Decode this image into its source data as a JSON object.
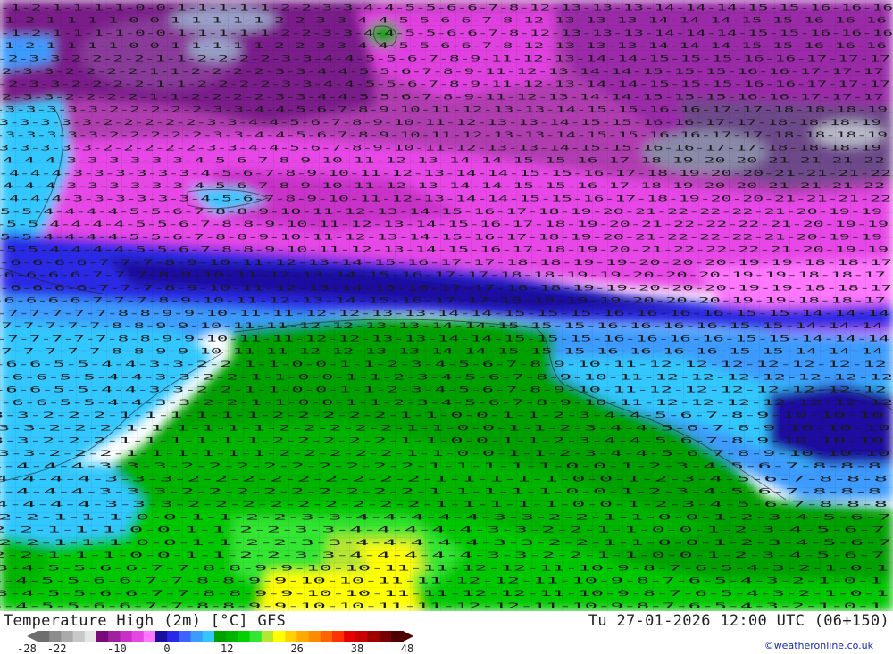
{
  "footer": {
    "title_left": "Temperature High (2m) [°C] GFS",
    "title_right": "Tu 27-01-2026 12:00 UTC (06+150)",
    "copyright": "©weatheronline.co.uk"
  },
  "scale": {
    "colors": [
      "#6e6e6e",
      "#8c8c8c",
      "#aaaaaa",
      "#c8c8c8",
      "#e6e6e6",
      "#7a0a7a",
      "#a020a0",
      "#c830c8",
      "#e646e6",
      "#ff78ff",
      "#1a10a0",
      "#2a2ae6",
      "#3c64ff",
      "#3c9bff",
      "#32c8ff",
      "#00a000",
      "#00b400",
      "#00d200",
      "#32e632",
      "#b4e632",
      "#ffff00",
      "#ffd200",
      "#ffaa00",
      "#ff8c00",
      "#ff6400",
      "#ff3200",
      "#e60000",
      "#c80000",
      "#a00000",
      "#780000",
      "#500000"
    ],
    "labels": [
      {
        "text": "-28",
        "value": -28
      },
      {
        "text": "-22",
        "value": -22
      },
      {
        "text": "-10",
        "value": -10
      },
      {
        "text": "0",
        "value": 0
      },
      {
        "text": "12",
        "value": 12
      },
      {
        "text": "26",
        "value": 26
      },
      {
        "text": "38",
        "value": 38
      },
      {
        "text": "48",
        "value": 48
      }
    ]
  },
  "map": {
    "grid_rows": [
      "-1-2-1-1-1-1-0-0-1-1-1-1-1-2-2-3-3-4-4-5-5-6-6-7-8-12-13-13-13-14-14-14-15-15-16-16-16",
      "-2-3-3-2-2-2-2-1-1-2-2-2-2-3-3-4-4-5-5-6-7-8-9-11-12-13-14-14-15-15-15-16-16-17-17-17",
      "-3-3-3-3-3-2-2-2-2-2-3-3-4-4-5-6-7-8-9-10-11-12-13-13-14-15-15-16-16-17-17-18-18-18-19",
      "-4-4-4-3-3-3-3-3-3-4-5-6-7-8-9-10-11-12-13-14-14-15-15-16-17-18-19-20-20-21-21-21-22",
      "-5-5-4-4-4-4-5-5-6-7-8-8-9-10-11-12-13-14-15-16-17-18-19-20-21-22-22-22-21-20-19-19",
      "-6-6-6-6-7-7-7-8-9-10-11-12-13-14-15-16-17-17-18-18-19-19-20-20-20-19-19-18-18-17",
      "-7-7-7-7-7-8-8-9-9-10-11-11-12-12-13-13-14-14-15-15-15-16-16-16-16-15-15-14-14-14",
      "-6-6-5-5-4-4-3-3-2-2-1-1-0-0-1-1-2-3-4-5-6-7-8-9-10-11-12-12-12-12-12-12-12",
      "3-3-2-2-2-1-1-1-1-1-1-2-2-2-2-2-1-1-0-0-1-1-2-3-4-4-5-6-7-8-9-10-10-10",
      "4-4-4-4-3-3-3-2-2-2-2-2-2-2-2-2-1-1-1-1-1-0-0-1-2-3-4-5-6-7-8-8-8",
      "2-2-1-1-1-0-0-1-1-2-2-3-3-4-4-4-4-4-3-3-2-2-1-1-0-0-1-2-3-4-5-6-7",
      "3-4-5-5-6-6-7-7-8-8-9-9-10-10-11-11-12-12-11-10-9-8-7-6-5-4-3-2-1-0-1"
    ]
  }
}
